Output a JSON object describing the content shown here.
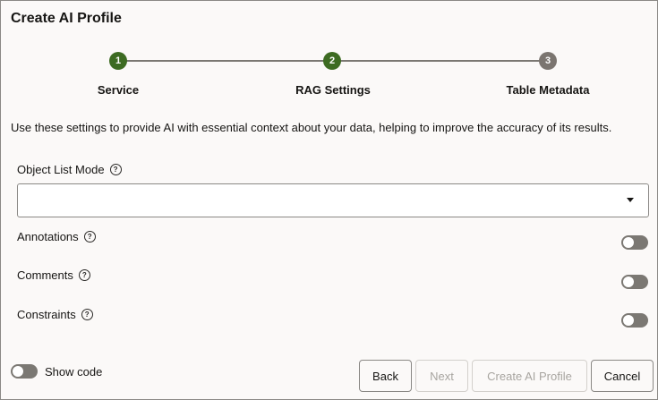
{
  "dialog": {
    "title": "Create AI Profile",
    "steps": [
      {
        "number": "1",
        "label": "Service",
        "state": "completed"
      },
      {
        "number": "2",
        "label": "RAG Settings",
        "state": "current"
      },
      {
        "number": "3",
        "label": "Table Metadata",
        "state": "upcoming"
      }
    ],
    "description": "Use these settings to provide AI with essential context about your data, helping to improve the accuracy of its results.",
    "object_list_mode": {
      "label": "Object List Mode",
      "value": ""
    },
    "toggles": [
      {
        "label": "Annotations",
        "on": false
      },
      {
        "label": "Comments",
        "on": false
      },
      {
        "label": "Constraints",
        "on": false
      }
    ],
    "footer": {
      "show_code_label": "Show code",
      "show_code_on": false,
      "back_label": "Back",
      "next_label": "Next",
      "create_label": "Create AI Profile",
      "cancel_label": "Cancel"
    }
  },
  "colors": {
    "step_done": "#3d6b22",
    "step_todo": "#7b7570",
    "toggle_off": "#7b7873"
  }
}
